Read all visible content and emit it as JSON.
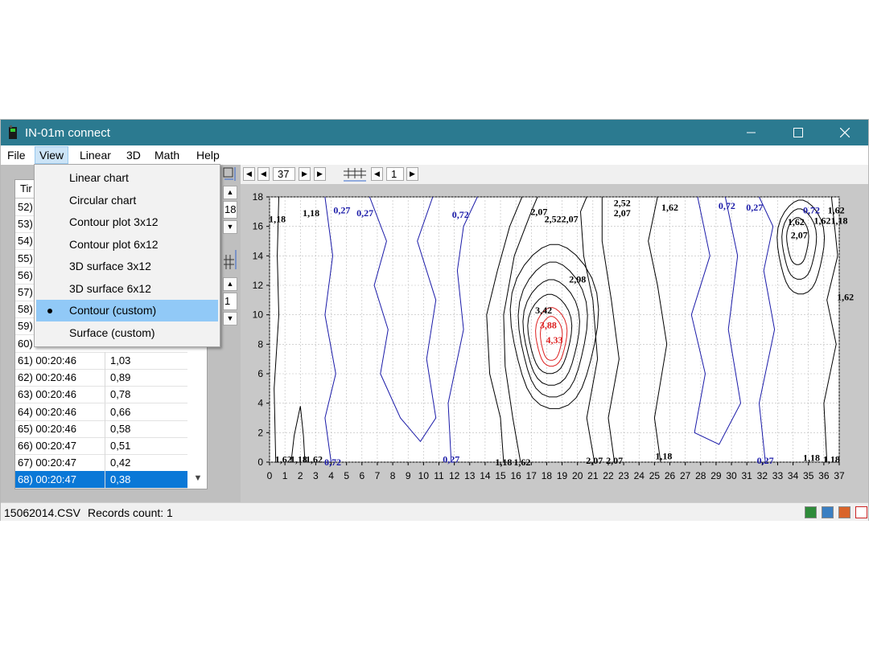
{
  "window": {
    "title": "IN-01m connect"
  },
  "menu": {
    "file": "File",
    "view": "View",
    "linear": "Linear",
    "three_d": "3D",
    "math": "Math",
    "help": "Help"
  },
  "view_menu": {
    "items": [
      "Linear chart",
      "Circular chart",
      "Contour plot 3x12",
      "Contour plot 6x12",
      "3D surface 3x12",
      "3D surface 6x12",
      "Contour (custom)",
      "Surface (custom)"
    ],
    "checked": "Contour (custom)"
  },
  "list": {
    "header": "Tir",
    "partial_rows": [
      "52)",
      "53)",
      "54)",
      "55)",
      "56)",
      "57)",
      "58)",
      "59)",
      "60)"
    ],
    "rows": [
      {
        "time": "61) 00:20:46",
        "value": "1,03"
      },
      {
        "time": "62) 00:20:46",
        "value": "0,89"
      },
      {
        "time": "63) 00:20:46",
        "value": "0,78"
      },
      {
        "time": "64) 00:20:46",
        "value": "0,66"
      },
      {
        "time": "65) 00:20:46",
        "value": "0,58"
      },
      {
        "time": "66) 00:20:47",
        "value": "0,51"
      },
      {
        "time": "67) 00:20:47",
        "value": "0,42"
      },
      {
        "time": "68) 00:20:47",
        "value": "0,38"
      }
    ],
    "selected_value": "0,38"
  },
  "toolbar": {
    "frame_value": "37",
    "step_value": "1"
  },
  "side": {
    "upper_value": "18",
    "lower_value": "1"
  },
  "status": {
    "file": "15062014.CSV",
    "records": "Records count: 1"
  },
  "icons": [
    "app-icon",
    "minimize-icon",
    "maximize-icon",
    "close-icon",
    "excel-icon",
    "image-icon",
    "export-icon",
    "pdf-icon"
  ],
  "colors": {
    "titlebar": "#2b7a90",
    "selection": "#0a78d7",
    "contour_black": "#000000",
    "contour_blue": "#1a1aa8",
    "contour_red": "#dd2020"
  },
  "chart_data": {
    "type": "heatmap",
    "x_ticks": [
      "0",
      "1",
      "2",
      "3",
      "4",
      "5",
      "6",
      "7",
      "8",
      "9",
      "10",
      "11",
      "12",
      "13",
      "14",
      "15",
      "16",
      "17",
      "18",
      "19",
      "20",
      "21",
      "22",
      "23",
      "24",
      "25",
      "26",
      "27",
      "28",
      "29",
      "30",
      "31",
      "32",
      "33",
      "34",
      "35",
      "36",
      "37"
    ],
    "y_ticks": [
      "0",
      "2",
      "4",
      "6",
      "8",
      "10",
      "12",
      "14",
      "16",
      "18"
    ],
    "xlim": [
      0,
      37
    ],
    "ylim": [
      0,
      18
    ],
    "grid": true,
    "contour_labels": [
      {
        "text": "1,18",
        "x": 0.5,
        "y": 16.5,
        "color": "#000000"
      },
      {
        "text": "1,18",
        "x": 2.7,
        "y": 16.9,
        "color": "#000000"
      },
      {
        "text": "0,27",
        "x": 4.7,
        "y": 17.1,
        "color": "#1a1aa8"
      },
      {
        "text": "0,27",
        "x": 6.2,
        "y": 16.9,
        "color": "#1a1aa8"
      },
      {
        "text": "0,72",
        "x": 12.4,
        "y": 16.8,
        "color": "#1a1aa8"
      },
      {
        "text": "2,07",
        "x": 17.5,
        "y": 17.0,
        "color": "#000000"
      },
      {
        "text": "2,52",
        "x": 18.4,
        "y": 16.5,
        "color": "#000000"
      },
      {
        "text": "2,07",
        "x": 19.5,
        "y": 16.5,
        "color": "#000000"
      },
      {
        "text": "2,52",
        "x": 22.9,
        "y": 17.6,
        "color": "#000000"
      },
      {
        "text": "2,07",
        "x": 22.9,
        "y": 16.9,
        "color": "#000000"
      },
      {
        "text": "1,62",
        "x": 26.0,
        "y": 17.3,
        "color": "#000000"
      },
      {
        "text": "0,72",
        "x": 29.7,
        "y": 17.4,
        "color": "#1a1aa8"
      },
      {
        "text": "0,27",
        "x": 31.5,
        "y": 17.3,
        "color": "#1a1aa8"
      },
      {
        "text": "0,72",
        "x": 35.2,
        "y": 17.1,
        "color": "#1a1aa8"
      },
      {
        "text": "1,62",
        "x": 36.8,
        "y": 17.1,
        "color": "#000000"
      },
      {
        "text": "1,62",
        "x": 34.2,
        "y": 16.3,
        "color": "#000000"
      },
      {
        "text": "1,62",
        "x": 35.9,
        "y": 16.4,
        "color": "#000000"
      },
      {
        "text": "1,18",
        "x": 37.0,
        "y": 16.4,
        "color": "#000000"
      },
      {
        "text": "2,07",
        "x": 34.4,
        "y": 15.4,
        "color": "#000000"
      },
      {
        "text": "2,98",
        "x": 20.0,
        "y": 12.4,
        "color": "#000000"
      },
      {
        "text": "3,42",
        "x": 17.8,
        "y": 10.3,
        "color": "#000000"
      },
      {
        "text": "3,88",
        "x": 18.1,
        "y": 9.3,
        "color": "#dd2020"
      },
      {
        "text": "4,33",
        "x": 18.5,
        "y": 8.3,
        "color": "#dd2020"
      },
      {
        "text": "1,62",
        "x": 37.4,
        "y": 11.2,
        "color": "#000000"
      },
      {
        "text": "1,18",
        "x": 25.6,
        "y": 0.4,
        "color": "#000000"
      },
      {
        "text": "1,62",
        "x": 0.9,
        "y": 0.2,
        "color": "#000000"
      },
      {
        "text": "1,18",
        "x": 1.9,
        "y": 0.2,
        "color": "#000000"
      },
      {
        "text": "1,62",
        "x": 2.9,
        "y": 0.2,
        "color": "#000000"
      },
      {
        "text": "0,72",
        "x": 4.1,
        "y": 0.0,
        "color": "#1a1aa8"
      },
      {
        "text": "0,27",
        "x": 11.8,
        "y": 0.2,
        "color": "#1a1aa8"
      },
      {
        "text": "1,18",
        "x": 15.2,
        "y": 0.0,
        "color": "#000000"
      },
      {
        "text": "1,62",
        "x": 16.4,
        "y": 0.0,
        "color": "#000000"
      },
      {
        "text": "2,07",
        "x": 21.1,
        "y": 0.1,
        "color": "#000000"
      },
      {
        "text": "2,07",
        "x": 22.4,
        "y": 0.1,
        "color": "#000000"
      },
      {
        "text": "0,27",
        "x": 32.2,
        "y": 0.1,
        "color": "#1a1aa8"
      },
      {
        "text": "1,18",
        "x": 35.2,
        "y": 0.3,
        "color": "#000000"
      },
      {
        "text": "1,18",
        "x": 36.5,
        "y": 0.2,
        "color": "#000000"
      }
    ]
  }
}
